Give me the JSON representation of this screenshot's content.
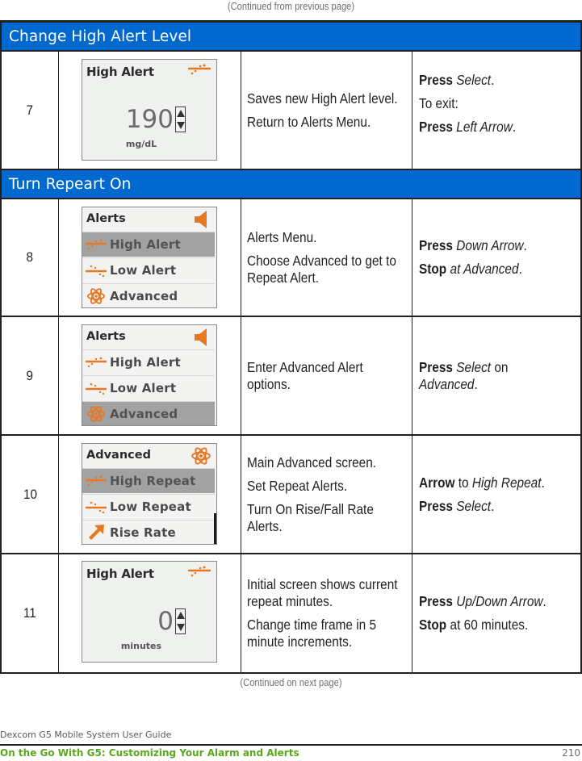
{
  "continued_top": "(Continued from previous page)",
  "continued_bottom": "(Continued on next page)",
  "colors": {
    "section_header": "#0069cf",
    "icon_accent": "#e87722",
    "chapter_green": "#5aa61d"
  },
  "sections": [
    {
      "title": "Change High Alert Level",
      "rows": [
        {
          "step": "7",
          "screen": {
            "type": "value",
            "title": "High Alert",
            "header_icon": "high-alert-icon",
            "value": "190",
            "unit": "mg/dL"
          },
          "description": [
            "Saves new High Alert level.",
            "Return to Alerts Menu."
          ],
          "actions": [
            {
              "bold": "Press",
              "rest": " ",
              "italic": "Select",
              "tail": "."
            },
            {
              "bold": "",
              "rest": "To exit:",
              "italic": "",
              "tail": ""
            },
            {
              "bold": "Press",
              "rest": " ",
              "italic": "Left Arrow",
              "tail": "."
            }
          ]
        }
      ]
    },
    {
      "title": "Turn Repeart On",
      "rows": [
        {
          "step": "8",
          "screen": {
            "type": "menu",
            "title": "Alerts",
            "header_icon": "speaker-icon",
            "items": [
              {
                "label": "High Alert",
                "icon": "high-alert-icon",
                "selected": true
              },
              {
                "label": "Low Alert",
                "icon": "low-alert-icon",
                "selected": false
              },
              {
                "label": "Advanced",
                "icon": "atom-icon",
                "selected": false
              }
            ]
          },
          "description": [
            "Alerts Menu.",
            "Choose Advanced to get to Repeat Alert."
          ],
          "actions": [
            {
              "bold": "Press",
              "rest": " ",
              "italic": "Down Arrow",
              "tail": "."
            },
            {
              "bold": "Stop",
              "rest": " ",
              "italic": "at Advanced",
              "tail": "."
            }
          ]
        },
        {
          "step": "9",
          "screen": {
            "type": "menu",
            "title": "Alerts",
            "header_icon": "speaker-icon",
            "items": [
              {
                "label": "High Alert",
                "icon": "high-alert-icon",
                "selected": false
              },
              {
                "label": "Low Alert",
                "icon": "low-alert-icon",
                "selected": false
              },
              {
                "label": "Advanced",
                "icon": "atom-icon",
                "selected": true
              }
            ]
          },
          "description": [
            "Enter Advanced Alert options."
          ],
          "actions": [
            {
              "bold": "Press",
              "rest": " ",
              "italic": "Select",
              "tail": " on"
            },
            {
              "bold": "",
              "rest": "",
              "italic": "Advanced",
              "tail": "."
            }
          ]
        },
        {
          "step": "10",
          "screen": {
            "type": "menu",
            "title": "Advanced",
            "header_icon": "atom-icon",
            "items": [
              {
                "label": "High Repeat",
                "icon": "high-alert-icon",
                "selected": true
              },
              {
                "label": "Low Repeat",
                "icon": "low-alert-icon",
                "selected": false
              },
              {
                "label": "Rise Rate",
                "icon": "rise-arrow-icon",
                "selected": false
              }
            ]
          },
          "description": [
            "Main Advanced screen.",
            "Set Repeat Alerts.",
            "Turn On Rise/Fall Rate Alerts."
          ],
          "actions": [
            {
              "bold": "Arrow",
              "rest": " to ",
              "italic": "High Repeat",
              "tail": "."
            },
            {
              "bold": "Press",
              "rest": " ",
              "italic": "Select",
              "tail": "."
            }
          ]
        },
        {
          "step": "11",
          "screen": {
            "type": "value",
            "title": "High Alert",
            "header_icon": "high-alert-icon",
            "value": "0",
            "unit": "minutes"
          },
          "description": [
            "Initial screen shows current repeat minutes.",
            "Change time frame in 5 minute increments."
          ],
          "actions": [
            {
              "bold": "Press",
              "rest": " ",
              "italic": "Up/Down Arrow",
              "tail": "."
            },
            {
              "bold": "Stop",
              "rest": " at 60 minutes.",
              "italic": "",
              "tail": ""
            }
          ]
        }
      ]
    }
  ],
  "footer": {
    "guide_title": "Dexcom G5 Mobile System User Guide",
    "chapter": "On the Go With G5: Customizing Your Alarm and Alerts",
    "page_number": "210"
  }
}
